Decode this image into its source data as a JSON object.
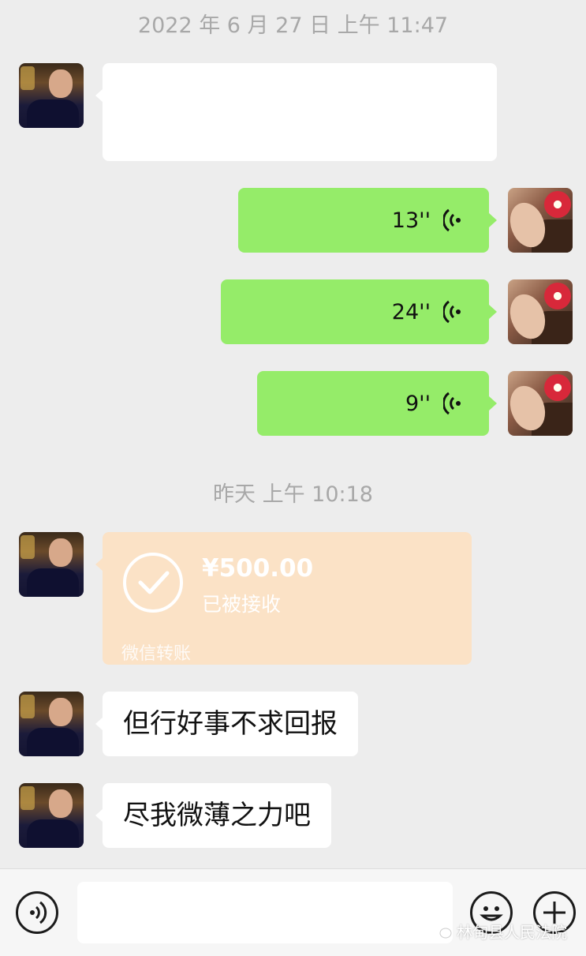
{
  "timestamps": {
    "first": "2022 年 6 月 27 日  上午 11:47",
    "second": "昨天  上午 10:18"
  },
  "voice_messages": [
    {
      "duration": "13''"
    },
    {
      "duration": "24''"
    },
    {
      "duration": "9''"
    }
  ],
  "transfer": {
    "amount": "¥500.00",
    "status": "已被接收",
    "label": "微信转账"
  },
  "text_messages": [
    {
      "text": "但行好事不求回报"
    },
    {
      "text": "尽我微薄之力吧"
    }
  ],
  "input_bar": {
    "voice_toggle_icon": "voice-icon",
    "emoji_icon": "emoji-icon",
    "more_icon": "plus-icon"
  },
  "watermark": {
    "text": "林甸县人民法院"
  },
  "colors": {
    "background": "#ededed",
    "sent_bubble": "#95ec69",
    "received_bubble": "#ffffff",
    "transfer_card": "#fbe2c6"
  }
}
